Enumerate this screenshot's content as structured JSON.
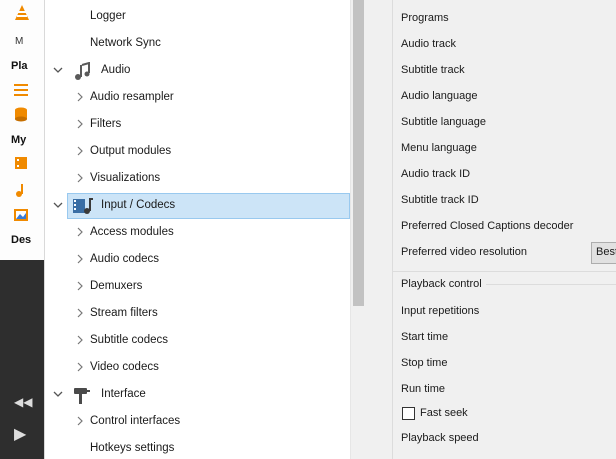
{
  "background_window": {
    "menu_label": "M",
    "sidebar_labels": [
      "Pla",
      "My",
      "Des"
    ]
  },
  "tree": {
    "rows": [
      {
        "label": "Logger",
        "level": 1,
        "arrow": "none"
      },
      {
        "label": "Network Sync",
        "level": 1,
        "arrow": "none"
      },
      {
        "label": "Audio",
        "level": 0,
        "arrow": "expanded",
        "icon": "audio-category-icon"
      },
      {
        "label": "Audio resampler",
        "level": 1,
        "arrow": "collapsed"
      },
      {
        "label": "Filters",
        "level": 1,
        "arrow": "collapsed"
      },
      {
        "label": "Output modules",
        "level": 1,
        "arrow": "collapsed"
      },
      {
        "label": "Visualizations",
        "level": 1,
        "arrow": "collapsed"
      },
      {
        "label": "Input / Codecs",
        "level": 0,
        "arrow": "expanded",
        "icon": "input-codecs-category-icon",
        "selected": true
      },
      {
        "label": "Access modules",
        "level": 1,
        "arrow": "collapsed"
      },
      {
        "label": "Audio codecs",
        "level": 1,
        "arrow": "collapsed"
      },
      {
        "label": "Demuxers",
        "level": 1,
        "arrow": "collapsed"
      },
      {
        "label": "Stream filters",
        "level": 1,
        "arrow": "collapsed"
      },
      {
        "label": "Subtitle codecs",
        "level": 1,
        "arrow": "collapsed"
      },
      {
        "label": "Video codecs",
        "level": 1,
        "arrow": "collapsed"
      },
      {
        "label": "Interface",
        "level": 0,
        "arrow": "expanded",
        "icon": "interface-category-icon"
      },
      {
        "label": "Control interfaces",
        "level": 1,
        "arrow": "collapsed"
      },
      {
        "label": "Hotkeys settings",
        "level": 1,
        "arrow": "none"
      }
    ]
  },
  "settings": {
    "track_options": [
      "Programs",
      "Audio track",
      "Subtitle track",
      "Audio language",
      "Subtitle language",
      "Menu language",
      "Audio track ID",
      "Subtitle track ID",
      "Preferred Closed Captions decoder",
      "Preferred video resolution"
    ],
    "resolution_button": "Best",
    "playback_section_title": "Playback control",
    "playback_options": [
      "Input repetitions",
      "Start time",
      "Stop time",
      "Run time"
    ],
    "fast_seek_label": "Fast seek",
    "fast_seek_checked": false,
    "playback_speed_label": "Playback speed"
  },
  "colors": {
    "selection_bg": "#cce4f7",
    "selection_border": "#99c9ef",
    "vlc_orange": "#f08a00"
  }
}
